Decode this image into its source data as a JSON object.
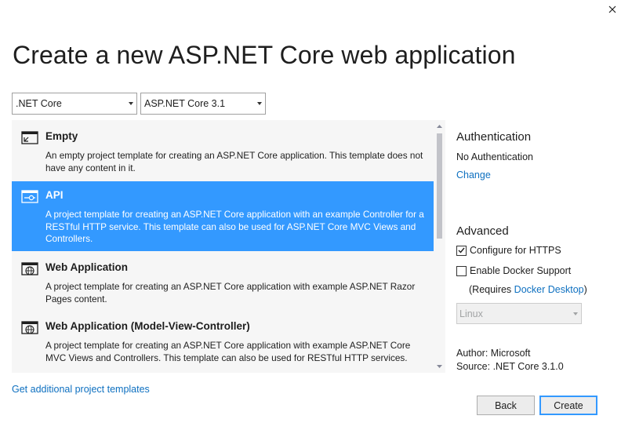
{
  "dialog": {
    "title": "Create a new ASP.NET Core web application",
    "close_icon": "close-icon"
  },
  "filters": {
    "framework": ".NET Core",
    "version": "ASP.NET Core 3.1"
  },
  "templates": [
    {
      "name": "Empty",
      "description": "An empty project template for creating an ASP.NET Core application. This template does not have any content in it.",
      "icon": "empty-template-icon",
      "selected": false
    },
    {
      "name": "API",
      "description": "A project template for creating an ASP.NET Core application with an example Controller for a RESTful HTTP service. This template can also be used for ASP.NET Core MVC Views and Controllers.",
      "icon": "api-template-icon",
      "selected": true
    },
    {
      "name": "Web Application",
      "description": "A project template for creating an ASP.NET Core application with example ASP.NET Razor Pages content.",
      "icon": "globe-icon",
      "selected": false
    },
    {
      "name": "Web Application (Model-View-Controller)",
      "description": "A project template for creating an ASP.NET Core application with example ASP.NET Core MVC Views and Controllers. This template can also be used for RESTful HTTP services.",
      "icon": "globe-icon",
      "selected": false
    }
  ],
  "authentication": {
    "heading": "Authentication",
    "value": "No Authentication",
    "change_link": "Change"
  },
  "advanced": {
    "heading": "Advanced",
    "https_label": "Configure for HTTPS",
    "https_checked": true,
    "docker_label": "Enable Docker Support",
    "docker_checked": false,
    "requires_prefix": "(Requires ",
    "docker_desktop_link": "Docker Desktop",
    "requires_suffix": ")",
    "os_value": "Linux"
  },
  "info": {
    "author_label": "Author:",
    "author_value": "Microsoft",
    "source_label": "Source:",
    "source_value": ".NET Core 3.1.0"
  },
  "footer": {
    "additional_link": "Get additional project templates",
    "back_label": "Back",
    "create_label": "Create"
  },
  "colors": {
    "selection": "#3399ff",
    "link": "#0e70c0"
  }
}
